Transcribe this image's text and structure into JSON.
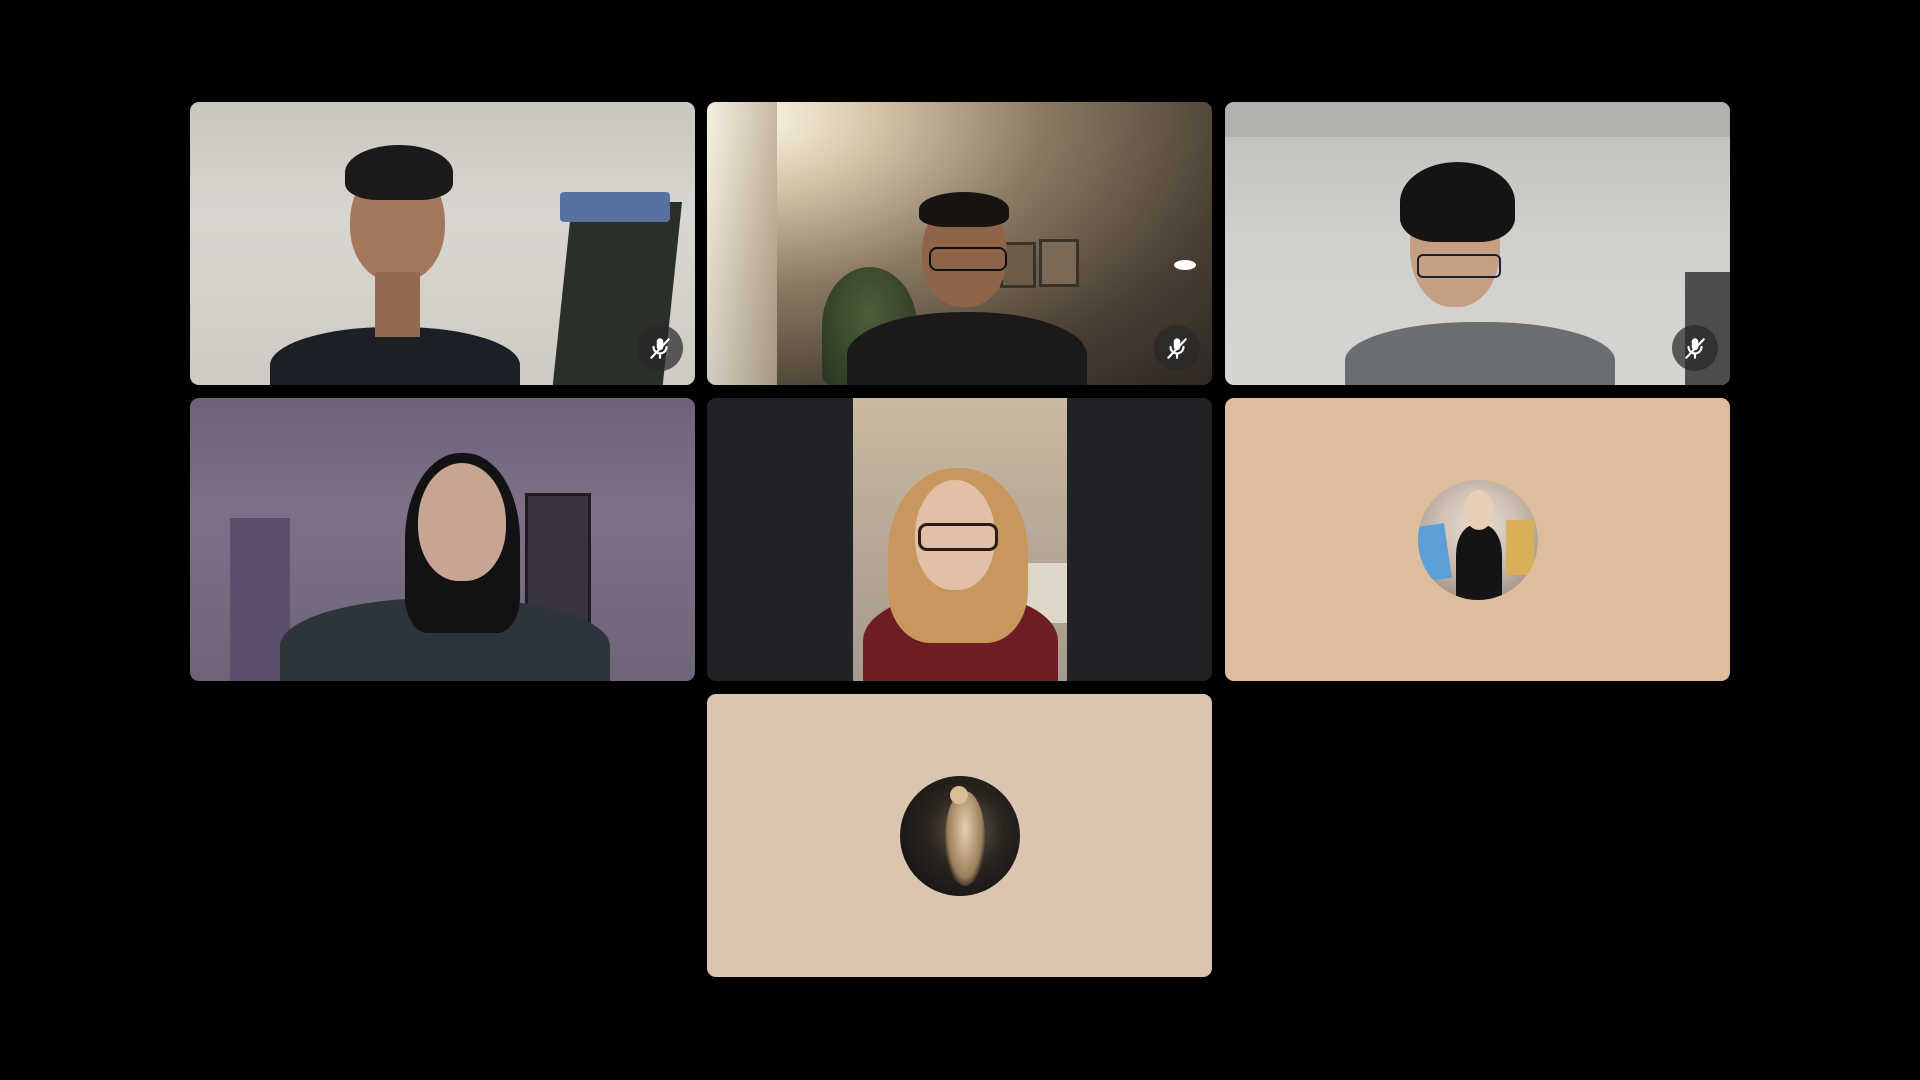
{
  "meeting": {
    "layout": "grid",
    "background_color": "#000000"
  },
  "participants": [
    {
      "tile": 1,
      "video": "on",
      "muted": true,
      "mic_icon": "mic-off-icon"
    },
    {
      "tile": 2,
      "video": "on",
      "muted": true,
      "mic_icon": "mic-off-icon"
    },
    {
      "tile": 3,
      "video": "on",
      "muted": true,
      "mic_icon": "mic-off-icon"
    },
    {
      "tile": 4,
      "video": "on",
      "muted": false
    },
    {
      "tile": 5,
      "video": "on",
      "muted": false
    },
    {
      "tile": 6,
      "video": "off",
      "muted": false,
      "avatar_icon": "profile-photo-avatar",
      "tile_color": "#dfbd9c"
    },
    {
      "tile": 7,
      "video": "off",
      "muted": false,
      "avatar_icon": "profile-photo-avatar",
      "tile_color": "#dbc4b0"
    }
  ]
}
